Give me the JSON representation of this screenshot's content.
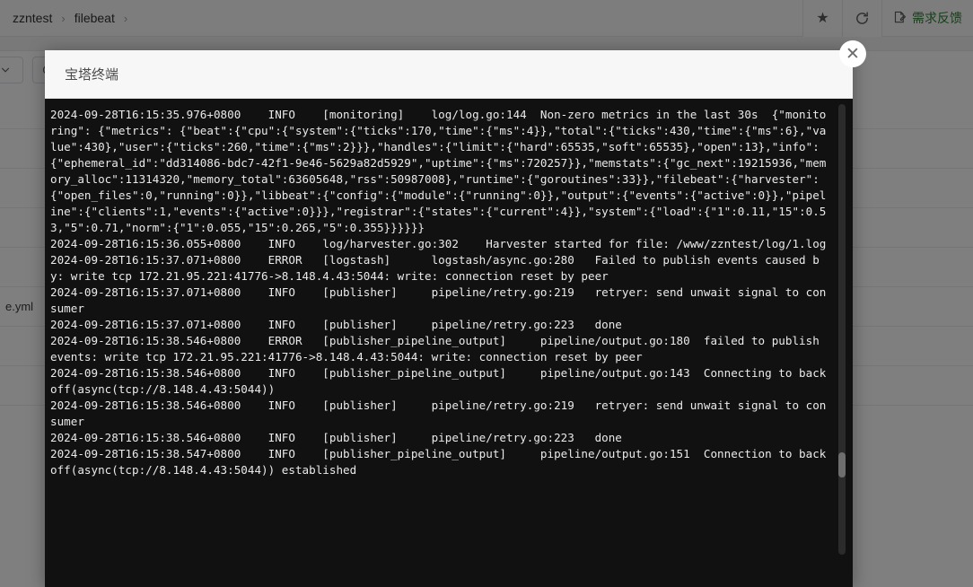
{
  "page": {
    "breadcrumb": {
      "items": [
        "zzntest",
        "filebeat"
      ],
      "separator": "›"
    },
    "actions": {
      "favorite_label": "★",
      "favorite_icon": "star-icon",
      "refresh_icon": "refresh-icon",
      "feedback_label": "需求反馈",
      "feedback_icon": "document-edit-icon",
      "feedback_color": "#2f7d32"
    },
    "toolbar": {
      "dropdown_icon": "chevron-down-icon",
      "search_icon": "search-icon"
    },
    "files": [
      {
        "name": ""
      },
      {
        "name": ""
      },
      {
        "name": ""
      },
      {
        "name": ""
      },
      {
        "name": ""
      },
      {
        "name": "e.yml"
      },
      {
        "name": ""
      },
      {
        "name": ""
      }
    ]
  },
  "modal": {
    "title": "宝塔终端",
    "close_label": "✕",
    "close_icon": "close-icon"
  },
  "terminal": {
    "output": "2024-09-28T16:15:35.976+0800    INFO    [monitoring]    log/log.go:144  Non-zero metrics in the last 30s  {\"monitoring\": {\"metrics\": {\"beat\":{\"cpu\":{\"system\":{\"ticks\":170,\"time\":{\"ms\":4}},\"total\":{\"ticks\":430,\"time\":{\"ms\":6},\"value\":430},\"user\":{\"ticks\":260,\"time\":{\"ms\":2}}},\"handles\":{\"limit\":{\"hard\":65535,\"soft\":65535},\"open\":13},\"info\":{\"ephemeral_id\":\"dd314086-bdc7-42f1-9e46-5629a82d5929\",\"uptime\":{\"ms\":720257}},\"memstats\":{\"gc_next\":19215936,\"memory_alloc\":11314320,\"memory_total\":63605648,\"rss\":50987008},\"runtime\":{\"goroutines\":33}},\"filebeat\":{\"harvester\":{\"open_files\":0,\"running\":0}},\"libbeat\":{\"config\":{\"module\":{\"running\":0}},\"output\":{\"events\":{\"active\":0}},\"pipeline\":{\"clients\":1,\"events\":{\"active\":0}}},\"registrar\":{\"states\":{\"current\":4}},\"system\":{\"load\":{\"1\":0.11,\"15\":0.53,\"5\":0.71,\"norm\":{\"1\":0.055,\"15\":0.265,\"5\":0.355}}}}}}\n2024-09-28T16:15:36.055+0800    INFO    log/harvester.go:302    Harvester started for file: /www/zzntest/log/1.log\n2024-09-28T16:15:37.071+0800    ERROR   [logstash]      logstash/async.go:280   Failed to publish events caused by: write tcp 172.21.95.221:41776->8.148.4.43:5044: write: connection reset by peer\n2024-09-28T16:15:37.071+0800    INFO    [publisher]     pipeline/retry.go:219   retryer: send unwait signal to consumer\n2024-09-28T16:15:37.071+0800    INFO    [publisher]     pipeline/retry.go:223   done\n2024-09-28T16:15:38.546+0800    ERROR   [publisher_pipeline_output]     pipeline/output.go:180  failed to publish events: write tcp 172.21.95.221:41776->8.148.4.43:5044: write: connection reset by peer\n2024-09-28T16:15:38.546+0800    INFO    [publisher_pipeline_output]     pipeline/output.go:143  Connecting to backoff(async(tcp://8.148.4.43:5044))\n2024-09-28T16:15:38.546+0800    INFO    [publisher]     pipeline/retry.go:219   retryer: send unwait signal to consumer\n2024-09-28T16:15:38.546+0800    INFO    [publisher]     pipeline/retry.go:223   done\n2024-09-28T16:15:38.547+0800    INFO    [publisher_pipeline_output]     pipeline/output.go:151  Connection to backoff(async(tcp://8.148.4.43:5044)) established"
  }
}
